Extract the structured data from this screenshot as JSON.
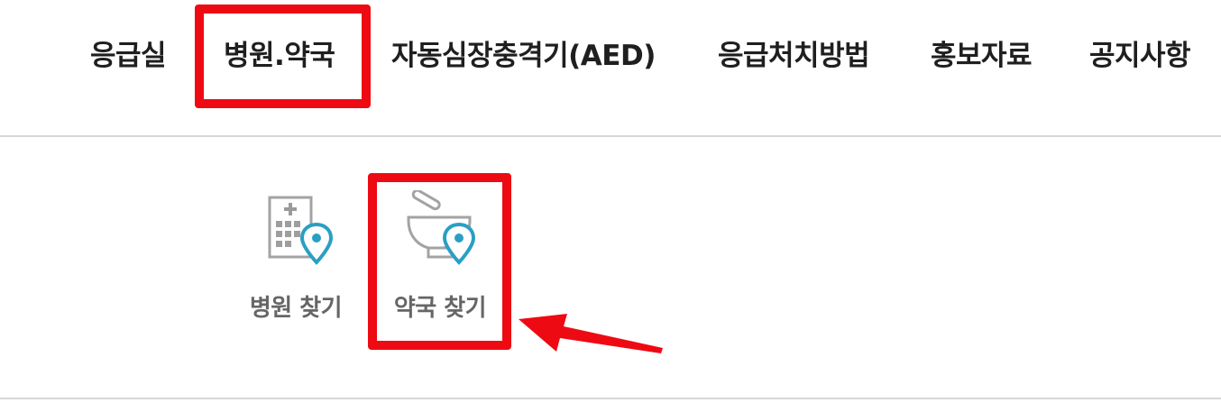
{
  "nav": {
    "items": [
      {
        "label": "응급실"
      },
      {
        "label": "병원.약국"
      },
      {
        "label": "자동심장충격기(AED)"
      },
      {
        "label": "응급처치방법"
      },
      {
        "label": "홍보자료"
      },
      {
        "label": "공지사항"
      }
    ],
    "selected": "병원.약국"
  },
  "submenu": {
    "items": [
      {
        "label": "병원 찾기",
        "icon": "hospital-location-icon"
      },
      {
        "label": "약국 찾기",
        "icon": "pharmacy-mortar-location-icon"
      }
    ]
  },
  "colors": {
    "highlight": "#ee0a12",
    "icon_gray": "#9e9e9e",
    "pin_teal": "#2a9fc4",
    "nav_text": "#1f1f1f",
    "sub_text": "#666666",
    "divider": "#d7d7d7"
  }
}
